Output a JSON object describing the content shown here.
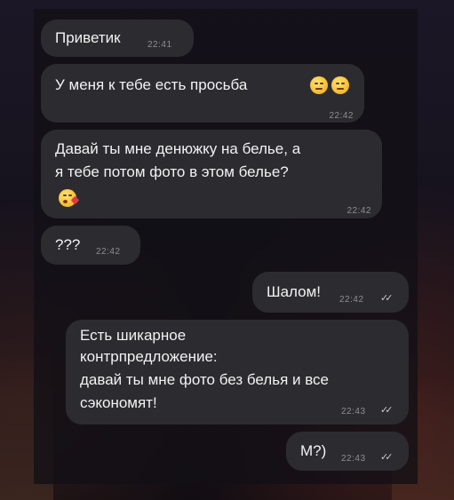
{
  "messages": [
    {
      "text": "Приветик",
      "time": "22:41"
    },
    {
      "text": "У меня к тебе есть просьба",
      "emojis": [
        "smirk-emoji",
        "smirk-emoji"
      ],
      "time": "22:42"
    },
    {
      "line1": "Давай ты мне денюжку на белье, а",
      "line2": "я тебе потом фото в этом белье?",
      "emoji": "kiss-emoji",
      "time": "22:42"
    },
    {
      "text": "???",
      "time": "22:42"
    },
    {
      "text": "Шалом!",
      "time": "22:42",
      "status": "read"
    },
    {
      "line1": "Есть шикарное",
      "line2": "контрпредложение:",
      "line3": "давай ты мне фото без белья и все",
      "line4": "сэкономят!",
      "time": "22:43",
      "status": "read"
    },
    {
      "text": "М?)",
      "time": "22:43",
      "status": "read"
    }
  ],
  "colors": {
    "bubble": "#2c2c30",
    "text": "#f2f2f2",
    "time": "#8d8d92"
  }
}
